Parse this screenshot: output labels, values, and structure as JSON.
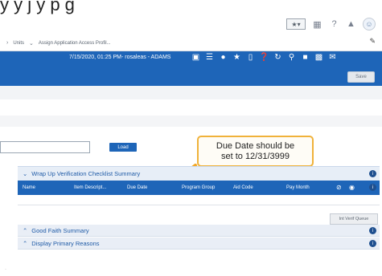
{
  "caption": "y    y    j   y p g",
  "topbar": {
    "search_label": "★▾",
    "icons": [
      "grid-icon",
      "help-icon",
      "bell-icon",
      "avatar-icon"
    ]
  },
  "nav": {
    "items": [
      {
        "label": "Units"
      },
      {
        "label": "Assign Application Access Profil..."
      }
    ]
  },
  "toolbar": {
    "status": "7/15/2020, 01:25 PM- rosaleas - ADAMS",
    "icons": [
      "briefcase-icon",
      "list-icon",
      "dollar-icon",
      "star-icon",
      "book-icon",
      "help-icon",
      "refresh-icon",
      "search-icon",
      "user-icon",
      "print-icon",
      "mail-icon"
    ],
    "save_label": "Save"
  },
  "search": {
    "load_label": "Load"
  },
  "callout": {
    "line1": "Due Date should be",
    "line2": "set to 12/31/3999"
  },
  "sections": {
    "wrap_up": "Wrap Up Verification Checklist Summary",
    "good_faith": "Good Faith Summary",
    "display_primary": "Display Primary Reasons"
  },
  "table": {
    "columns": [
      "Name",
      "Item Descript...",
      "Due Date",
      "Program Group",
      "Aid Code",
      "Pay Month"
    ]
  },
  "int_verif_label": "Int Verif Queue",
  "colors": {
    "accent": "#1e65b8",
    "callout_border": "#f0b23a",
    "arrow": "#f3a623"
  }
}
